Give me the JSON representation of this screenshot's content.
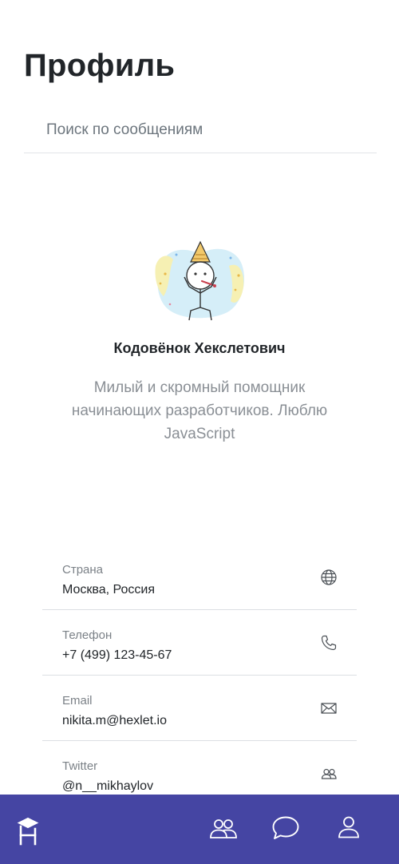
{
  "page": {
    "title": "Профиль"
  },
  "search": {
    "placeholder": "Поиск по сообщениям"
  },
  "user": {
    "name": "Кодовёнок Хекслетович",
    "bio": "Милый и скромный помощник начинающих разработчиков. Люблю JavaScript"
  },
  "info": [
    {
      "label": "Страна",
      "value": "Москва, Россия",
      "icon": "globe-icon"
    },
    {
      "label": "Телефон",
      "value": "+7 (499) 123-45-67",
      "icon": "phone-icon"
    },
    {
      "label": "Email",
      "value": "nikita.m@hexlet.io",
      "icon": "mail-icon"
    },
    {
      "label": "Twitter",
      "value": "@n__mikhaylov",
      "icon": "people-icon"
    }
  ],
  "nav": {
    "items": [
      "hexlet-logo-icon",
      "friends-icon",
      "chat-icon",
      "profile-icon"
    ]
  },
  "colors": {
    "nav_bg": "#4545a3",
    "text": "#212529",
    "muted": "#7b8187"
  }
}
